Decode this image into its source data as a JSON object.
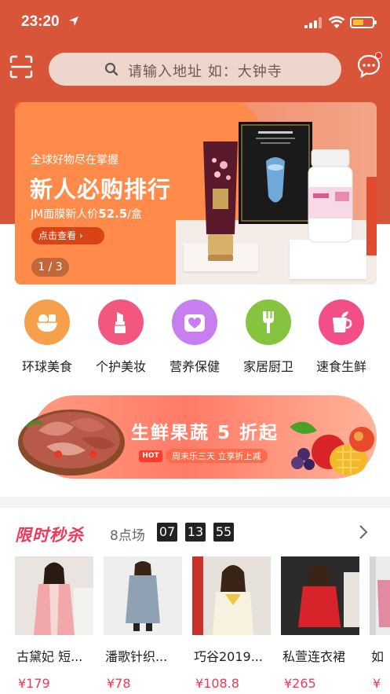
{
  "status_bar": {
    "time": "23:20"
  },
  "header": {
    "search_placeholder": "请输入地址 如：大钟寺",
    "accent_color": "#d8553a"
  },
  "banner": {
    "subtitle": "全球好物尽在掌握",
    "title": "新人必购排行",
    "price_prefix": "JM面膜新人价",
    "price_value": "52.5",
    "price_suffix": "/盒",
    "button_label": "点击查看 ›",
    "pager": "1 / 3"
  },
  "categories": [
    {
      "label": "环球美食",
      "color": "#f7a04c",
      "icon": "fruit-basket-icon"
    },
    {
      "label": "个护美妆",
      "color": "#f2587f",
      "icon": "lipstick-icon"
    },
    {
      "label": "营养保健",
      "color": "#c77ff0",
      "icon": "heart-icon"
    },
    {
      "label": "家居厨卫",
      "color": "#86c43f",
      "icon": "fork-icon"
    },
    {
      "label": "速食生鲜",
      "color": "#f24f86",
      "icon": "cup-icon"
    }
  ],
  "promo": {
    "title": "生鲜果蔬 5 折起",
    "hot_tag": "HOT",
    "subtitle": "周末乐三天 立享折上减"
  },
  "flash_sale": {
    "title": "限时秒杀",
    "session": "8点场",
    "countdown": [
      "07",
      "13",
      "55"
    ],
    "title_color": "#f0375c"
  },
  "products": [
    {
      "name": "古黛妃 短...",
      "price": "¥179"
    },
    {
      "name": "潘歌针织...",
      "price": "¥78"
    },
    {
      "name": "巧谷2019...",
      "price": "¥108.8"
    },
    {
      "name": "私萱连衣裙",
      "price": "¥265"
    },
    {
      "name": "如",
      "price": "¥"
    }
  ]
}
